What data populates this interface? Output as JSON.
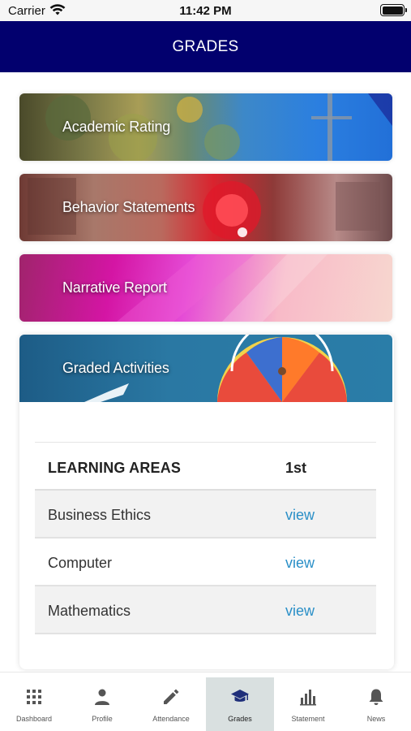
{
  "status_bar": {
    "carrier": "Carrier",
    "time": "11:42 PM",
    "wifi_icon": "wifi-icon",
    "battery_icon": "battery-icon",
    "battery_level": 1.0
  },
  "header": {
    "title": "GRADES",
    "background_color": "#02006e"
  },
  "cards": [
    {
      "label": "Academic Rating"
    },
    {
      "label": "Behavior Statements"
    },
    {
      "label": "Narrative Report"
    },
    {
      "label": "Graded Activities"
    }
  ],
  "grades_table": {
    "columns": [
      "LEARNING AREAS",
      "1st"
    ],
    "rows": [
      {
        "subject": "Business Ethics",
        "action": "view"
      },
      {
        "subject": "Computer",
        "action": "view"
      },
      {
        "subject": "Mathematics",
        "action": "view"
      }
    ],
    "link_color": "#2a8fc7"
  },
  "tabbar": {
    "active_tab": "Grades",
    "active_background": "#d9e0e0",
    "tabs": [
      {
        "label": "Dashboard",
        "icon": "grid-icon"
      },
      {
        "label": "Profile",
        "icon": "person-icon"
      },
      {
        "label": "Attendance",
        "icon": "pencil-icon"
      },
      {
        "label": "Grades",
        "icon": "graduation-cap-icon"
      },
      {
        "label": "Statement",
        "icon": "bar-chart-icon"
      },
      {
        "label": "News",
        "icon": "bell-icon"
      }
    ]
  }
}
